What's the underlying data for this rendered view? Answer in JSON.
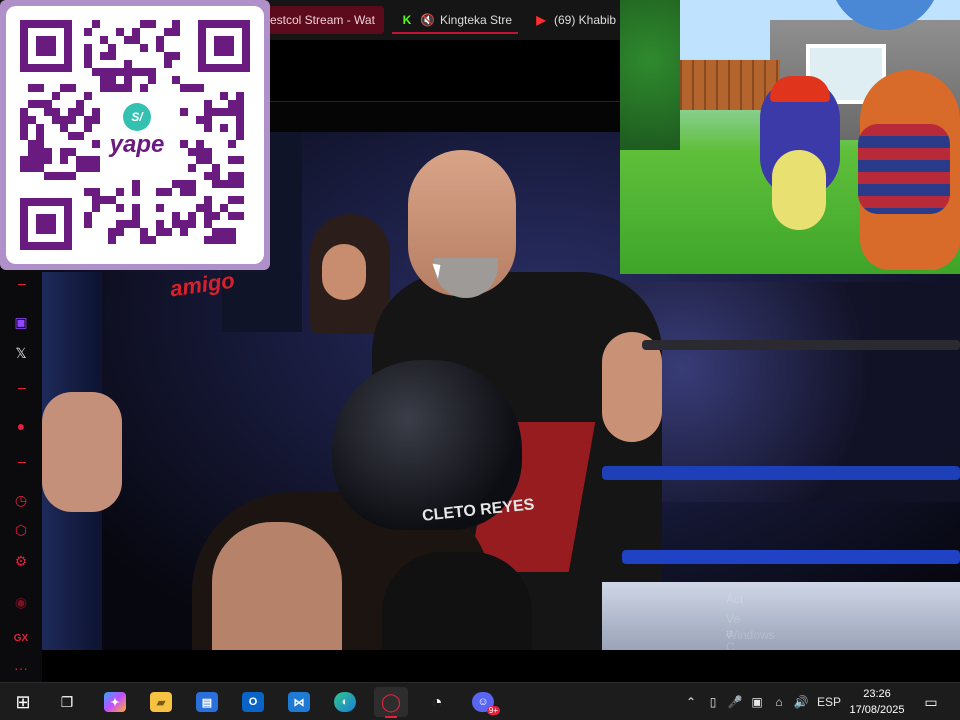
{
  "browser": {
    "tabs": [
      {
        "label": "estcol Stream - Wat",
        "icon": "tab-icon",
        "active": true
      },
      {
        "label": "Kingteka Stre",
        "icon": "kick-icon",
        "active": false
      },
      {
        "label": "(69) Khabib",
        "icon": "youtube-icon",
        "active": false
      }
    ]
  },
  "qr": {
    "logo_text": "yape",
    "logo_badge": "S/"
  },
  "sidebar": {
    "items": [
      {
        "icon": "twitch-icon",
        "glyph": "▣"
      },
      {
        "icon": "x-icon",
        "glyph": "𝕏"
      },
      {
        "icon": "record-icon",
        "glyph": "●"
      },
      {
        "icon": "clock-icon",
        "glyph": "◷"
      },
      {
        "icon": "extensions-icon",
        "glyph": "⬡"
      },
      {
        "icon": "settings-icon",
        "glyph": "⚙"
      },
      {
        "icon": "opera-gx-icon",
        "glyph": "◉"
      },
      {
        "icon": "gx-label",
        "glyph": "GX"
      },
      {
        "icon": "more-icon",
        "glyph": "···"
      }
    ]
  },
  "video": {
    "banner_text": "amigo",
    "headgear_text": "CLETO REYES",
    "watermark_lines": [
      "Act",
      "Ve a C",
      "Windows"
    ]
  },
  "taskbar": {
    "apps": [
      {
        "name": "windows-start-icon",
        "glyph": "⊞"
      },
      {
        "name": "task-view-icon",
        "glyph": "❐"
      },
      {
        "name": "copilot-icon",
        "glyph": "✦"
      },
      {
        "name": "file-explorer-icon",
        "glyph": "▰"
      },
      {
        "name": "microsoft-store-icon",
        "glyph": "▤"
      },
      {
        "name": "outlook-icon",
        "glyph": "O"
      },
      {
        "name": "vscode-icon",
        "glyph": "⋈"
      },
      {
        "name": "edge-icon",
        "glyph": "◐"
      },
      {
        "name": "opera-gx-taskbar-icon",
        "glyph": "◯"
      },
      {
        "name": "speed-app-icon",
        "glyph": "◔"
      },
      {
        "name": "discord-icon",
        "glyph": "☺"
      }
    ],
    "tray": {
      "language": "ESP",
      "time": "23:26",
      "date": "17/08/2025",
      "notification_badge": "9+"
    }
  },
  "colors": {
    "accent": "#c21433",
    "qr_purple": "#6a1b80",
    "sidebar_red": "#e3203d",
    "taskbar_bg": "#1c1c1c"
  }
}
